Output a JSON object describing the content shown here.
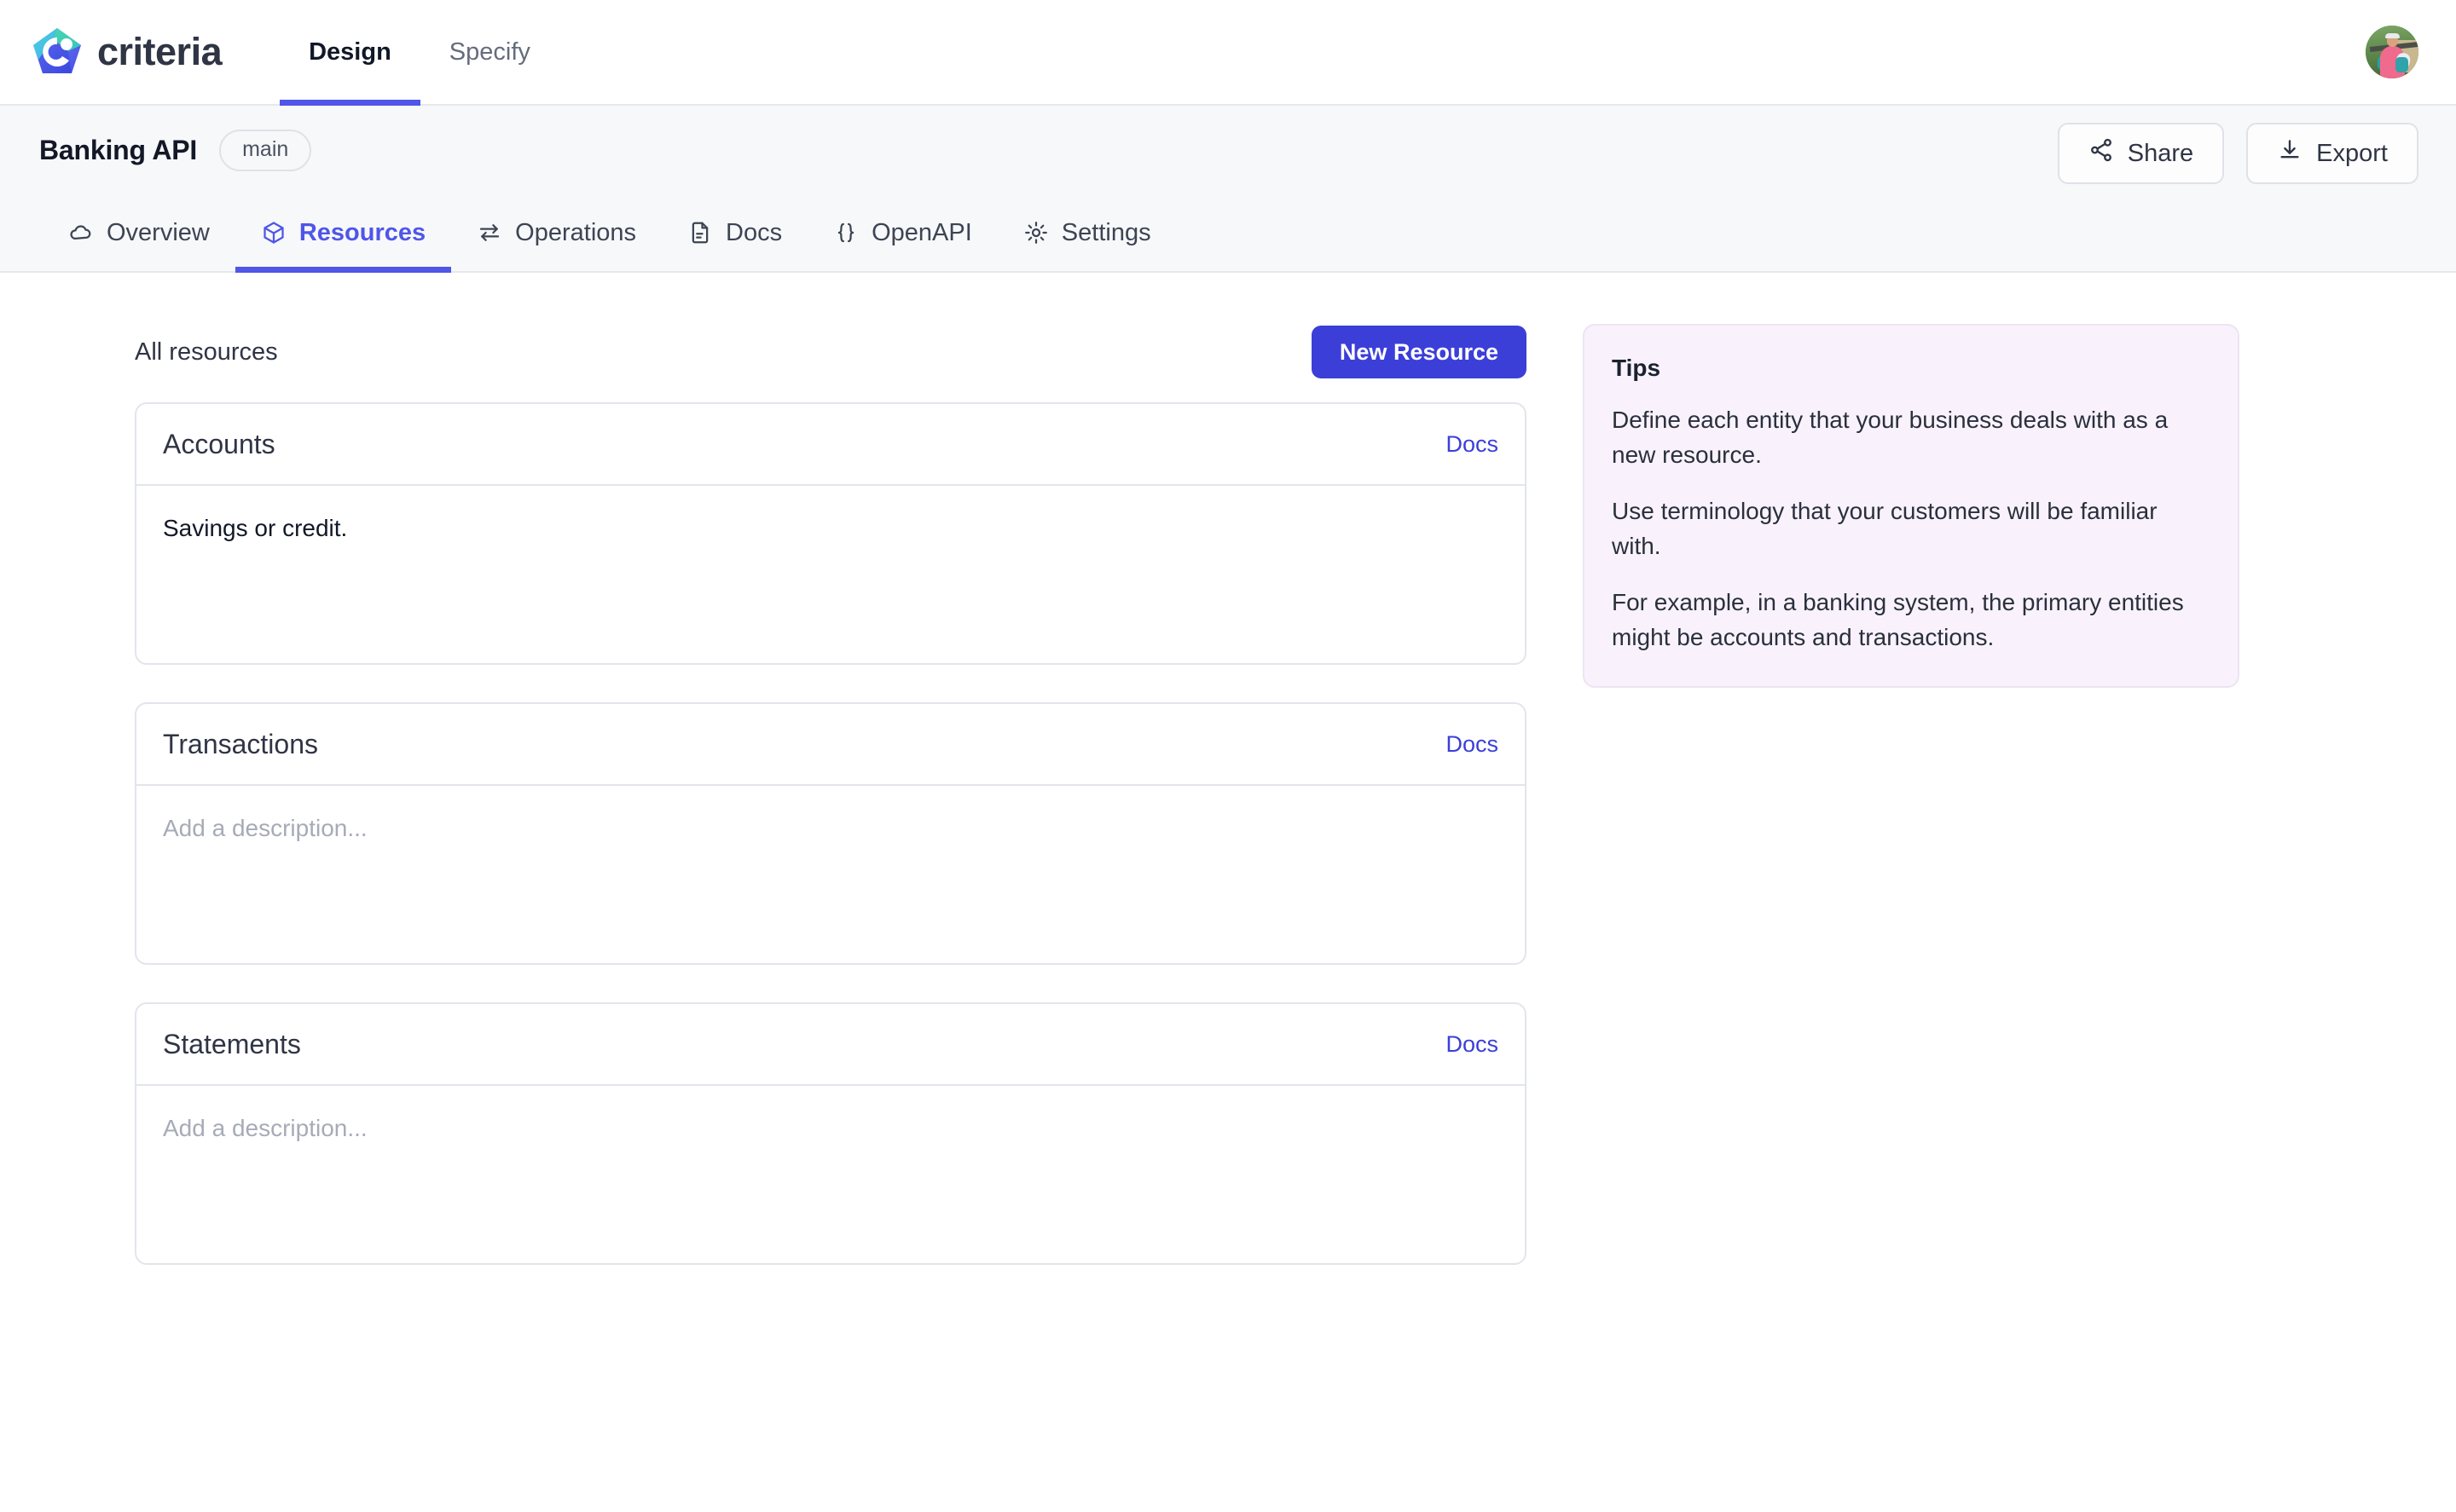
{
  "app": {
    "brand_name": "criteria",
    "logo_icon": "criteria-logo-icon",
    "avatar_icon": "user-avatar"
  },
  "main_tabs": [
    {
      "label": "Design",
      "active": true
    },
    {
      "label": "Specify",
      "active": false
    }
  ],
  "project": {
    "title": "Banking API",
    "branch": "main",
    "share_label": "Share",
    "share_icon": "share-icon",
    "export_label": "Export",
    "export_icon": "download-icon"
  },
  "sub_tabs": [
    {
      "label": "Overview",
      "icon": "cloud-icon",
      "active": false
    },
    {
      "label": "Resources",
      "icon": "cube-icon",
      "active": true
    },
    {
      "label": "Operations",
      "icon": "transfer-icon",
      "active": false
    },
    {
      "label": "Docs",
      "icon": "file-icon",
      "active": false
    },
    {
      "label": "OpenAPI",
      "icon": "braces-icon",
      "active": false
    },
    {
      "label": "Settings",
      "icon": "gear-icon",
      "active": false
    }
  ],
  "resources_panel": {
    "list_title": "All resources",
    "new_button_label": "New Resource",
    "docs_link_label": "Docs",
    "description_placeholder": "Add a description...",
    "items": [
      {
        "name": "Accounts",
        "description": "Savings or credit.",
        "has_description": true
      },
      {
        "name": "Transactions",
        "description": "",
        "has_description": false
      },
      {
        "name": "Statements",
        "description": "",
        "has_description": false
      }
    ]
  },
  "tips": {
    "title": "Tips",
    "paragraphs": [
      "Define each entity that your business deals with as a new resource.",
      "Use terminology that your customers will be familiar with.",
      "For example, in a banking system, the primary entities might be accounts and transactions."
    ]
  },
  "colors": {
    "accent": "#4F56E8",
    "button": "#3B3FD8",
    "link": "#3B3FD8",
    "band_bg": "#F7F8FA",
    "tips_bg": "#F9F2FC",
    "border": "#E2E5EB"
  }
}
